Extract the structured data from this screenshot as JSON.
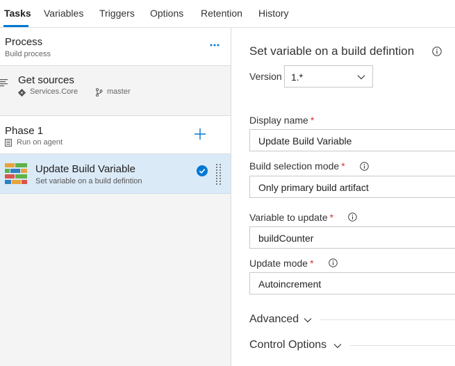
{
  "tabs": [
    {
      "label": "Tasks"
    },
    {
      "label": "Variables"
    },
    {
      "label": "Triggers"
    },
    {
      "label": "Options"
    },
    {
      "label": "Retention"
    },
    {
      "label": "History"
    }
  ],
  "process": {
    "title": "Process",
    "subtitle": "Build process"
  },
  "sources": {
    "title": "Get sources",
    "repo": "Services.Core",
    "branch": "master"
  },
  "phase": {
    "title": "Phase 1",
    "subtitle": "Run on agent"
  },
  "task": {
    "title": "Update Build Variable",
    "subtitle": "Set variable on a build defintion"
  },
  "details": {
    "heading": "Set variable on a build defintion",
    "version_label": "Version",
    "version_value": "1.*",
    "required_mark": "*",
    "fields": [
      {
        "label": "Display name",
        "value": "Update Build Variable"
      },
      {
        "label": "Build selection mode",
        "value": "Only primary build artifact"
      },
      {
        "label": "Variable to update",
        "value": "buildCounter"
      },
      {
        "label": "Update mode",
        "value": "Autoincrement"
      }
    ],
    "sections": [
      {
        "label": "Advanced"
      },
      {
        "label": "Control Options"
      }
    ]
  },
  "colors": {
    "accent": "#0078d4",
    "selected_row": "#dbeaf7",
    "required": "#d13438"
  }
}
